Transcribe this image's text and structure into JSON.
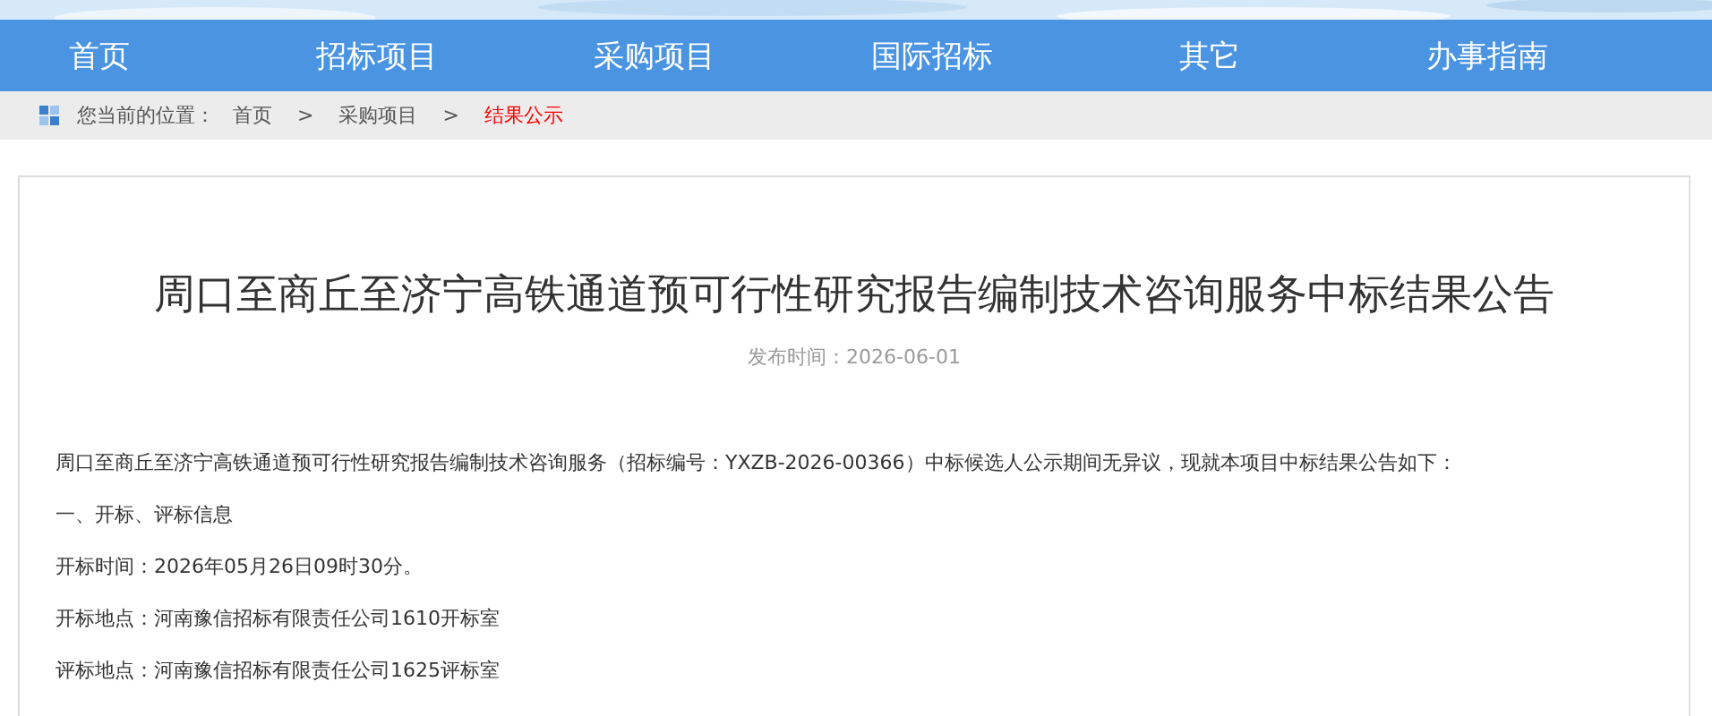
{
  "nav": [
    "首页",
    "招标项目",
    "采购项目",
    "国际招标",
    "其它",
    "办事指南"
  ],
  "breadcrumb": {
    "label": "您当前的位置：",
    "items": [
      {
        "text": "首页",
        "current": false
      },
      {
        "text": "采购项目",
        "current": false
      },
      {
        "text": "结果公示",
        "current": true
      }
    ],
    "separator": ">"
  },
  "article": {
    "title": "周口至商丘至济宁高铁通道预可行性研究报告编制技术咨询服务中标结果公告",
    "date": "发布时间：2026-06-01",
    "paragraphs": [
      "周口至商丘至济宁高铁通道预可行性研究报告编制技术咨询服务（招标编号：YXZB-2026-00366）中标候选人公示期间无异议，现就本项目中标结果公告如下：",
      "一、开标、评标信息",
      "开标时间：2026年05月26日09时30分。",
      "开标地点：河南豫信招标有限责任公司1610开标室",
      "评标地点：河南豫信招标有限责任公司1625评标室"
    ]
  }
}
